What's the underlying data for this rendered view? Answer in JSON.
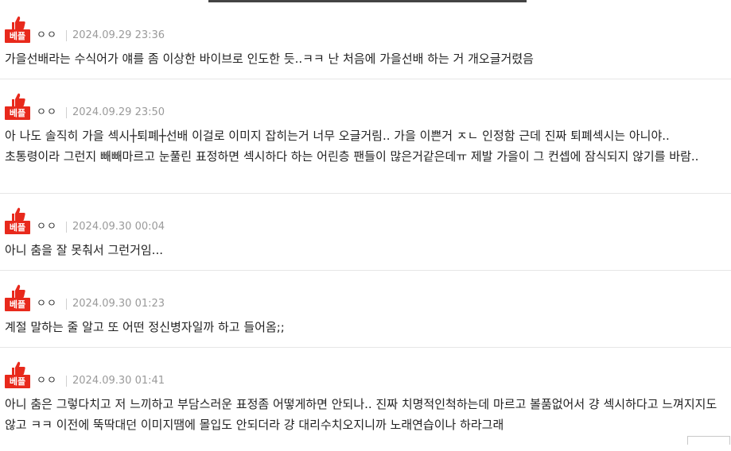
{
  "badge_label": "베플",
  "colors": {
    "badge": "#e8291c",
    "date": "#9a9a9a",
    "separator": "#e6e6e6"
  },
  "icon": "thumbs-up-icon",
  "comments": [
    {
      "nick": "ㅇㅇ",
      "date": "2024.09.29 23:36",
      "text": "가을선배라는 수식어가 얘를 좀 이상한 바이브로 인도한 듯..ㅋㅋ 난 처음에 가을선배 하는 거 개오글거렸음"
    },
    {
      "nick": "ㅇㅇ",
      "date": "2024.09.29 23:50",
      "text": "아 나도 솔직히 가을 섹시┼퇴폐┼선배 이걸로 이미지 잡히는거 너무 오글거림.. 가을 이쁜거 ㅈㄴ 인정함 근데 진짜 퇴폐섹시는 아니야.. 초통령이라 그런지 빼빼마르고 눈풀린 표정하면 섹시하다 하는 어린층 팬들이 많은거같은데ㅠ 제발 가을이 그 컨셉에 잠식되지 않기를 바람.."
    },
    {
      "nick": "ㅇㅇ",
      "date": "2024.09.30 00:04",
      "text": "아니 춤을 잘 못춰서 그런거임..."
    },
    {
      "nick": "ㅇㅇ",
      "date": "2024.09.30 01:23",
      "text": "계절 말하는 줄 알고 또 어떤 정신병자일까 하고 들어옴;;"
    },
    {
      "nick": "ㅇㅇ",
      "date": "2024.09.30 01:41",
      "text": "아니 춤은 그렇다치고 저 느끼하고 부담스러운 표정좀 어떻게하면 안되나.. 진짜 치명적인척하는데 마르고 볼품없어서 걍 섹시하다고 느껴지지도 않고 ㅋㅋ 이전에 뚝딱대던 이미지땜에 몰입도 안되더라 걍 대리수치오지니까 노래연습이나 하라그래"
    }
  ]
}
